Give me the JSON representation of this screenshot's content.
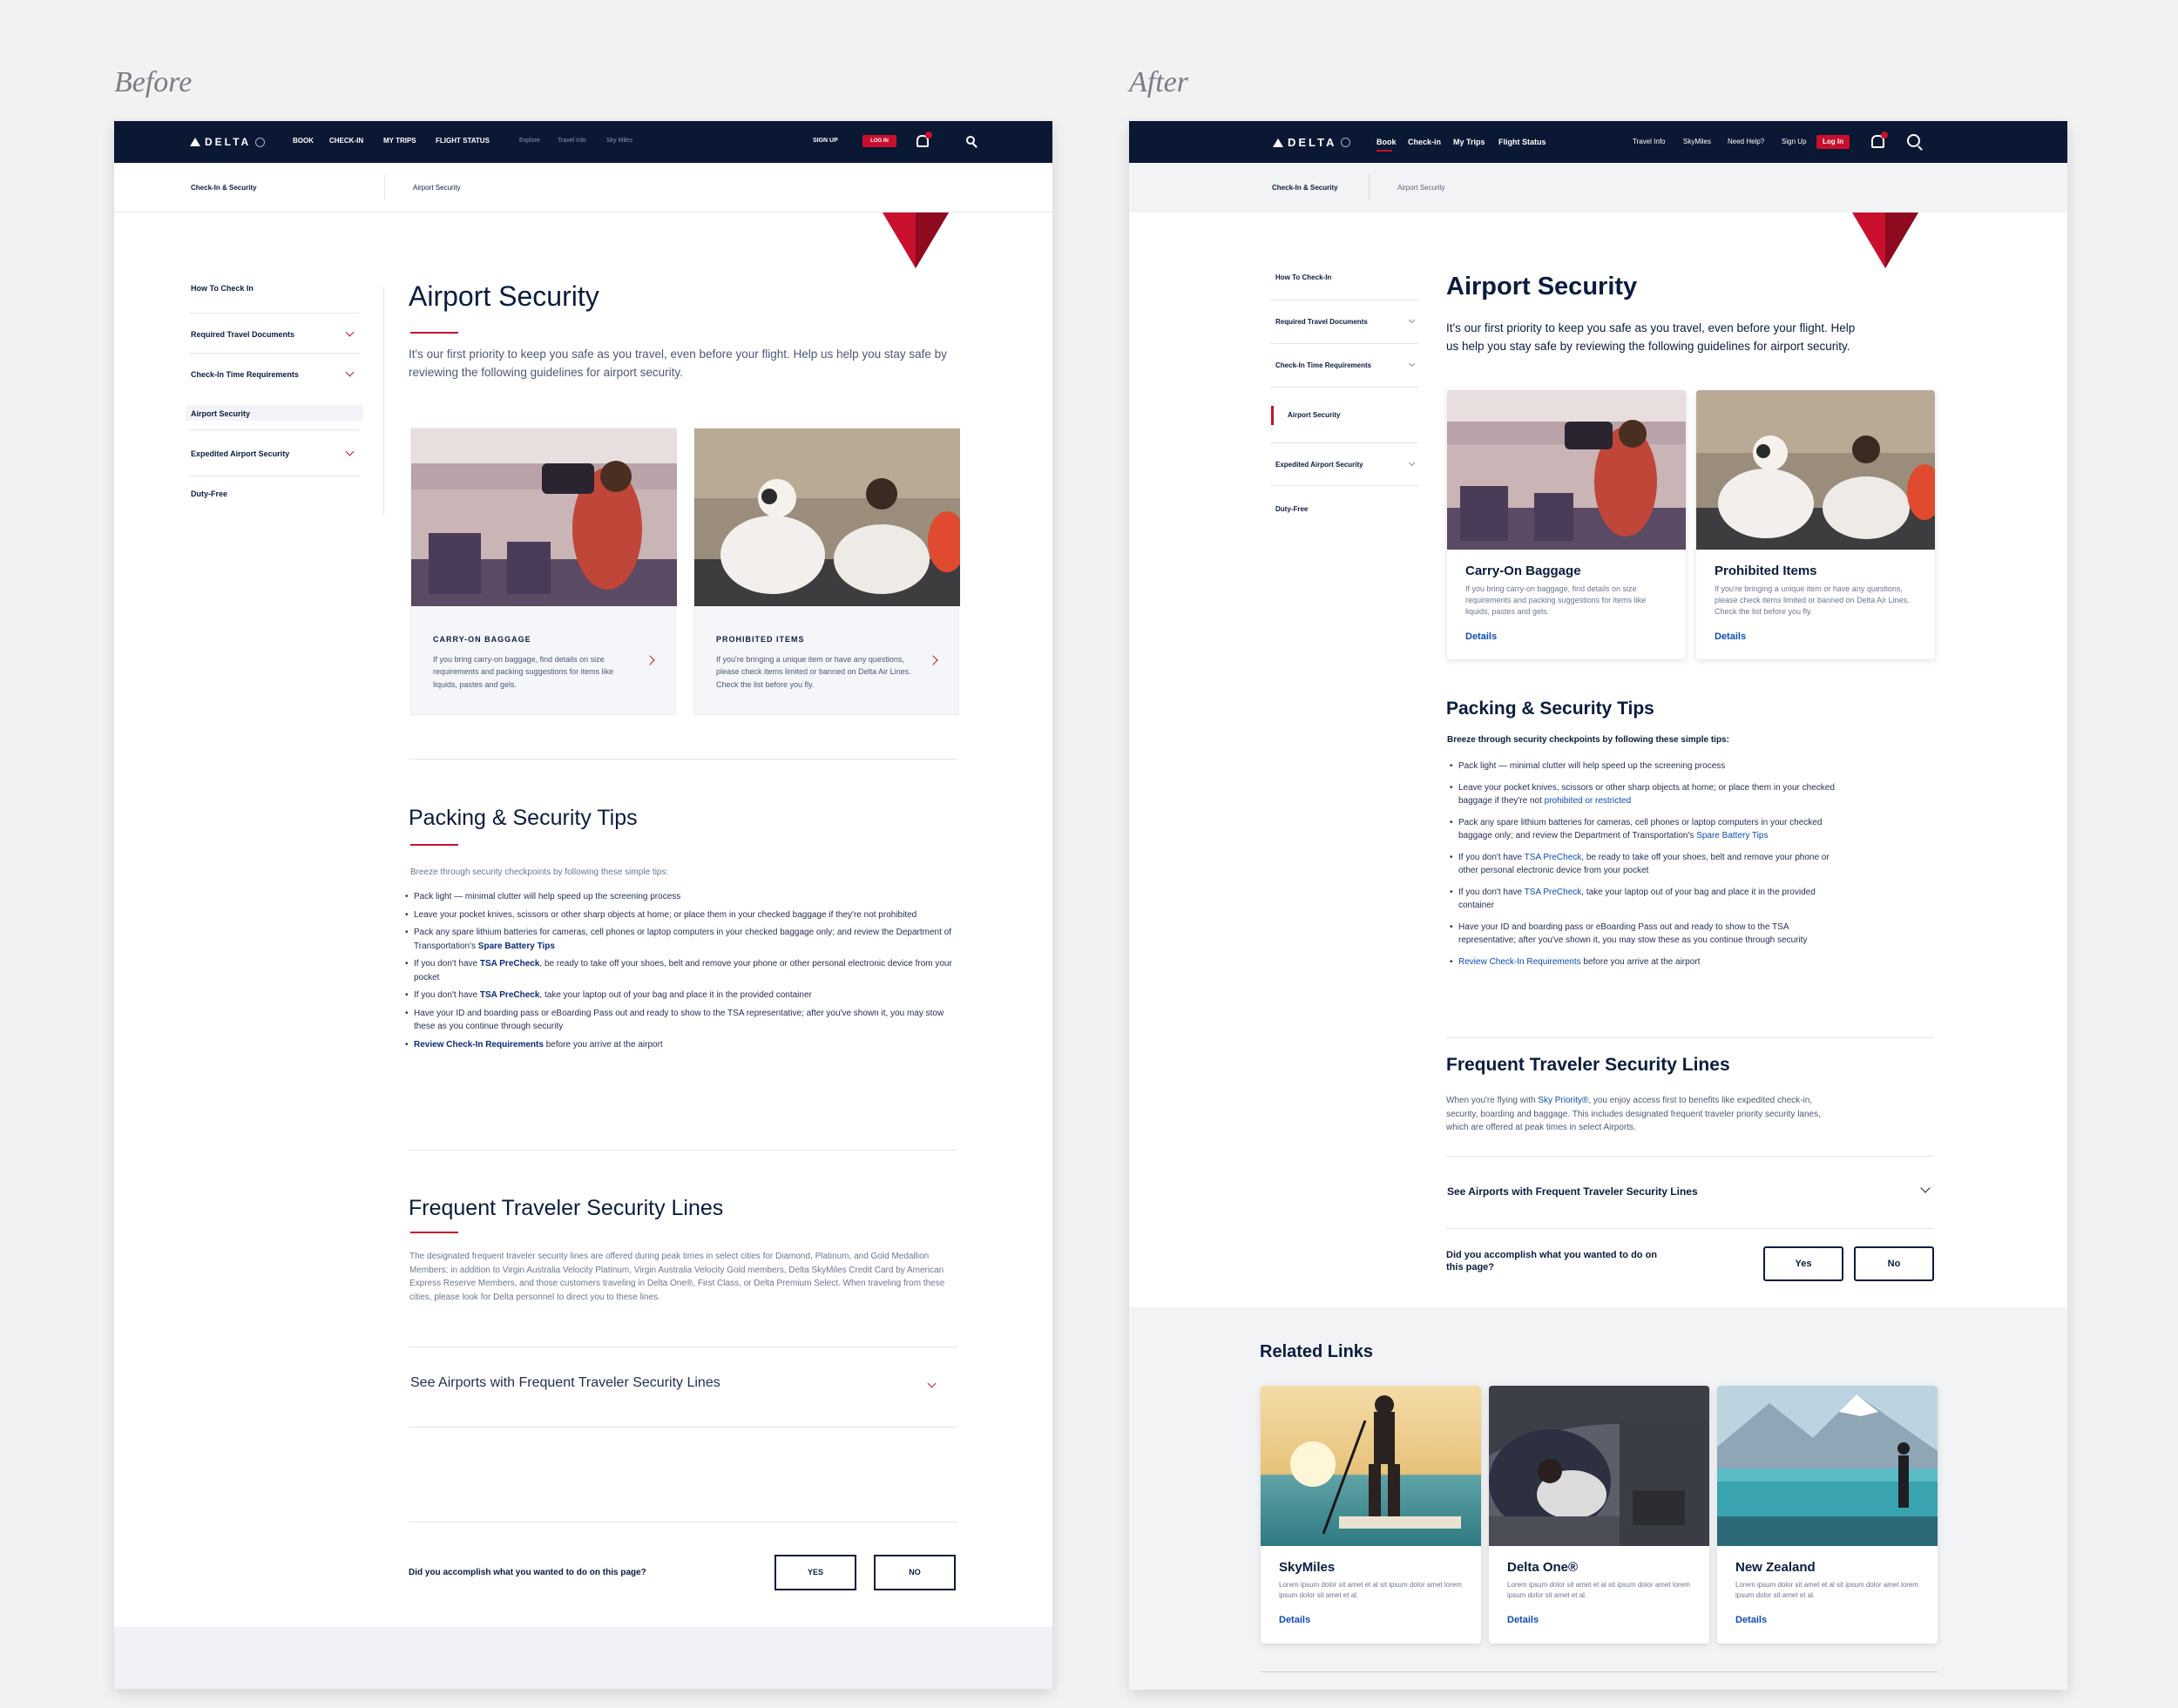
{
  "labels": {
    "before": "Before",
    "after": "After"
  },
  "colors": {
    "navy": "#0b1833",
    "red": "#c8102e",
    "link": "#0d4bb8"
  },
  "before": {
    "nav": {
      "brand": "DELTA",
      "items": [
        "BOOK",
        "CHECK-IN",
        "MY TRIPS",
        "FLIGHT STATUS"
      ],
      "sub_items": [
        "Explore",
        "Travel Info",
        "Sky Miles"
      ],
      "signup": "SIGN UP",
      "login": "LOG IN"
    },
    "breadcrumb": {
      "section": "Check-In & Security",
      "page": "Airport Security"
    },
    "sidebar": [
      "How To Check In",
      "Required Travel Documents",
      "Check-In Time Requirements",
      "Airport Security",
      "Expedited Airport Security",
      "Duty-Free"
    ],
    "title": "Airport Security",
    "intro": "It's our first priority to keep you safe as you travel, even before your flight. Help us help you stay safe by reviewing the following guidelines for airport security.",
    "cards": [
      {
        "caption": "CARRY-ON BAGGAGE",
        "text": "If you bring carry-on baggage, find details on size requirements and packing suggestions for items like liquids, pastes and gels."
      },
      {
        "caption": "PROHIBITED ITEMS",
        "text": "If you're bringing a unique item or have any questions, please check items limited or banned on Delta Air Lines. Check the list before you fly."
      }
    ],
    "tips_title": "Packing & Security Tips",
    "tips_intro": "Breeze through security checkpoints by following these simple tips:",
    "tips": [
      {
        "pre": "Pack light — minimal clutter will help speed up the screening process",
        "link": "",
        "post": ""
      },
      {
        "pre": "Leave your pocket knives, scissors or other sharp objects at home; or place them in your checked baggage if they're not prohibited",
        "link": "",
        "post": ""
      },
      {
        "pre": "Pack any spare lithium batteries for cameras, cell phones or laptop computers in your checked baggage only; and review the Department of Transportation's ",
        "link": "Spare Battery Tips",
        "post": ""
      },
      {
        "pre": "If you don't have ",
        "link": "TSA PreCheck",
        "post": ", be ready to take off your shoes, belt and remove your phone or other personal electronic device from your pocket"
      },
      {
        "pre": "If you don't have ",
        "link": "TSA PreCheck",
        "post": ", take your laptop out of your bag and place it in the provided container"
      },
      {
        "pre": "Have your ID and boarding pass or eBoarding Pass out and ready to show to the TSA representative; after you've shown it, you may stow these as you continue through security",
        "link": "",
        "post": ""
      },
      {
        "pre": "",
        "link": "Review Check-In Requirements",
        "post": " before you arrive at the airport"
      }
    ],
    "ftsl_title": "Frequent Traveler Security Lines",
    "ftsl_text": "The designated frequent traveler security lines are offered during peak times in select cities for Diamond, Platinum, and Gold Medallion Members; in addition to Virgin Australia Velocity Platinum, Virgin Australia Velocity Gold members, Delta SkyMiles Credit Card by American Express Reserve Members, and those customers traveling in Delta One®, First Class, or Delta Premium Select. When traveling from these cities, please look for Delta personnel to direct you to these lines.",
    "accordion": "See Airports with Frequent Traveler Security Lines",
    "feedback": {
      "question": "Did you accomplish what you wanted to do on this page?",
      "yes": "YES",
      "no": "NO"
    }
  },
  "after": {
    "nav": {
      "brand": "DELTA",
      "items": [
        "Book",
        "Check-in",
        "My Trips",
        "Flight Status"
      ],
      "right_items": [
        "Travel Info",
        "SkyMiles",
        "Need Help?",
        "Sign Up"
      ],
      "login": "Log In"
    },
    "breadcrumb": {
      "section": "Check-In & Security",
      "page": "Airport Security"
    },
    "sidebar": [
      "How To Check-In",
      "Required Travel Documents",
      "Check-In Time Requirements",
      "Airport Security",
      "Expedited Airport Security",
      "Duty-Free"
    ],
    "title": "Airport Security",
    "intro": "It's our first priority to keep you safe as you travel, even before your flight. Help us help you stay safe by reviewing the following guidelines for airport security.",
    "cards": [
      {
        "title": "Carry-On Baggage",
        "text": "If you bring carry-on baggage, find details on size requirements and packing suggestions for items like liquids, pastes and gels.",
        "link": "Details"
      },
      {
        "title": "Prohibited Items",
        "text": "If you're bringing a unique item or have any questions, please check items limited or banned on Delta Air Lines. Check the list before you fly.",
        "link": "Details"
      }
    ],
    "tips_title": "Packing & Security Tips",
    "tips_intro": "Breeze through security checkpoints by following these simple tips:",
    "tips": [
      {
        "pre": "Pack light — minimal clutter will help speed up the screening process",
        "link": "",
        "post": ""
      },
      {
        "pre": "Leave your pocket knives, scissors or other sharp objects at home; or place them in your checked baggage if they're not ",
        "link": "prohibited or restricted",
        "post": ""
      },
      {
        "pre": "Pack any spare lithium batteries for cameras, cell phones or laptop computers in your checked baggage only; and review the Department of Transportation's ",
        "link": "Spare Battery Tips",
        "post": ""
      },
      {
        "pre": "If you don't have ",
        "link": "TSA PreCheck",
        "post": ", be ready to take off your shoes, belt and remove your phone or other personal electronic device from your pocket"
      },
      {
        "pre": "If you don't have ",
        "link": "TSA PreCheck",
        "post": ", take your laptop out of your bag and place it in the provided container"
      },
      {
        "pre": "Have your ID and boarding pass or eBoarding Pass out and ready to show to the TSA representative; after you've shown it, you may stow these as you continue through security",
        "link": "",
        "post": ""
      },
      {
        "pre": "",
        "link": "Review Check-In Requirements",
        "post": " before you arrive at the airport"
      }
    ],
    "ftsl_title": "Frequent Traveler Security Lines",
    "ftsl_pre": "When you're flying with ",
    "ftsl_link": "Sky Priority®",
    "ftsl_post": ", you enjoy access first to benefits like expedited check-in, security, boarding and baggage. This includes designated frequent traveler priority security lanes, which are offered at peak times in select Airports.",
    "accordion": "See Airports with Frequent Traveler Security Lines",
    "feedback": {
      "question": "Did you accomplish what you wanted to do on this page?",
      "yes": "Yes",
      "no": "No"
    },
    "related_title": "Related Links",
    "related": [
      {
        "title": "SkyMiles",
        "text": "Lorem ipsum dolor sit amet et al sit ipsum dolor amet lorem ipsum dolor sit amet et al.",
        "link": "Details"
      },
      {
        "title": "Delta One®",
        "text": "Lorem ipsum dolor sit amet et al sit ipsum dolor amet lorem ipsum dolor sit amet et al.",
        "link": "Details"
      },
      {
        "title": "New Zealand",
        "text": "Lorem ipsum dolor sit amet et al sit ipsum dolor amet lorem ipsum dolor sit amet et al.",
        "link": "Details"
      }
    ]
  }
}
